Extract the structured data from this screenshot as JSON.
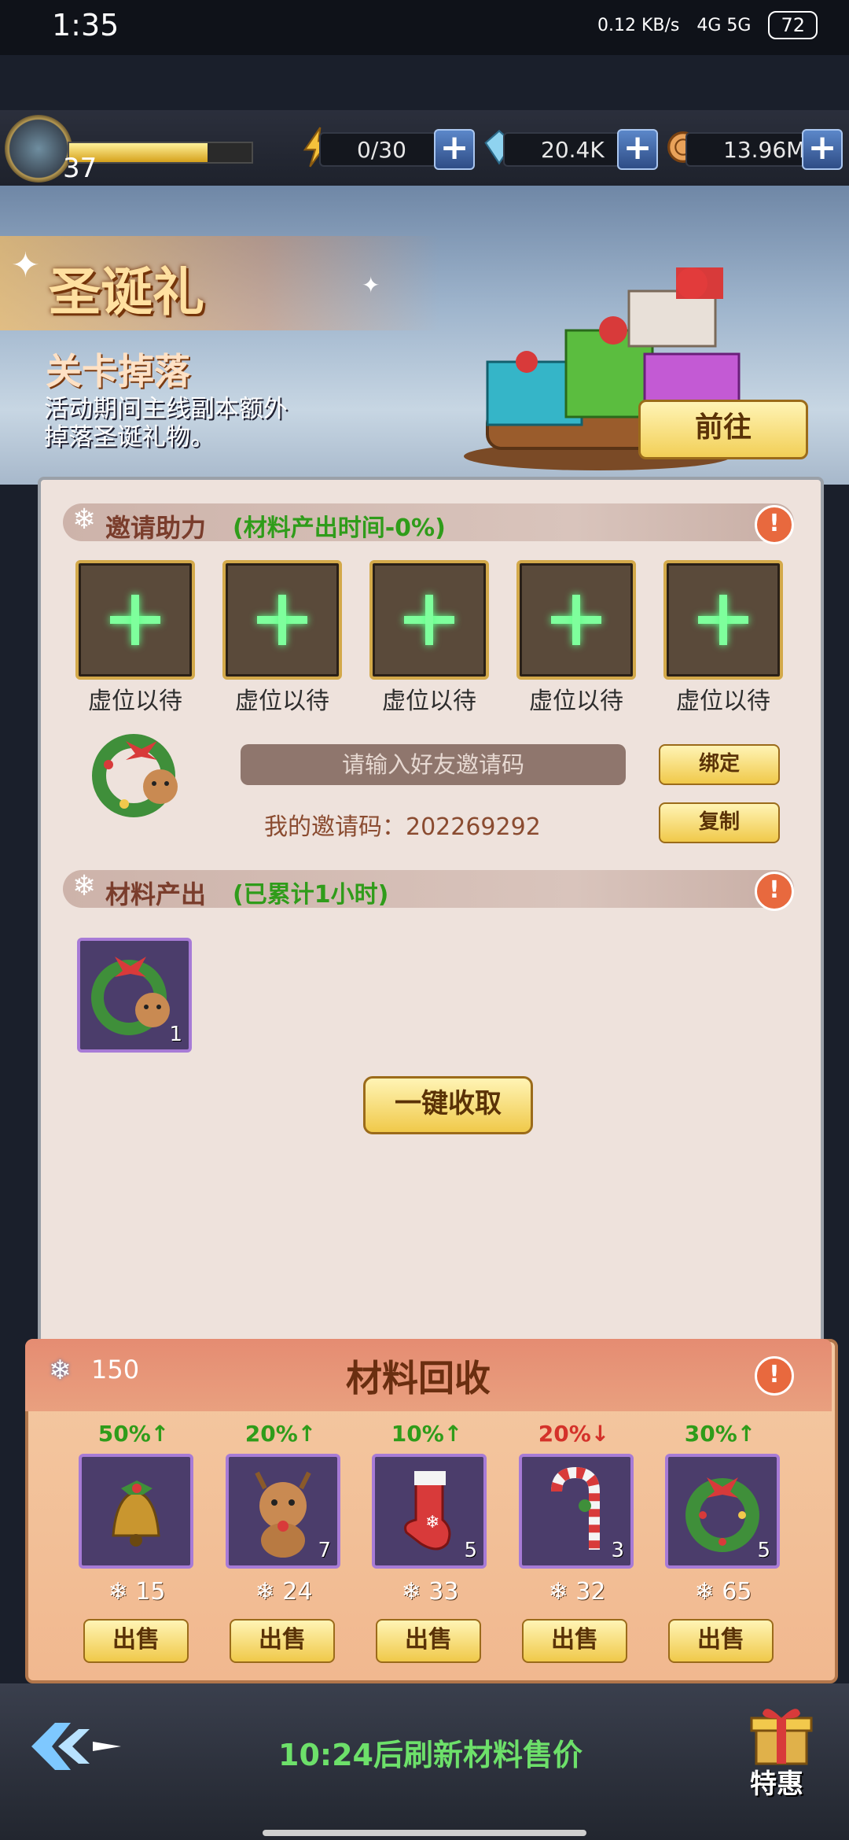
{
  "status": {
    "time": "1:35",
    "net_speed": "0.12 KB/s",
    "signal": "4G 5G",
    "battery": "72"
  },
  "player": {
    "level": "37",
    "xp_progress": 0.76
  },
  "resources": [
    {
      "icon": "energy-bolt-icon",
      "value": "0/30"
    },
    {
      "icon": "diamond-icon",
      "value": "20.4K"
    },
    {
      "icon": "coin-icon",
      "value": "13.96M"
    }
  ],
  "banner": {
    "title": "圣诞礼",
    "subtitle": "关卡掉落",
    "desc": "活动期间主线副本额外掉落圣诞礼物。",
    "goto_label": "前往"
  },
  "invite": {
    "header": "邀请助力",
    "header_note": "(材料产出时间-0%)",
    "slots": [
      "虚位以待",
      "虚位以待",
      "虚位以待",
      "虚位以待",
      "虚位以待"
    ],
    "input_placeholder": "请输入好友邀请码",
    "bind_label": "绑定",
    "copy_label": "复制",
    "my_code_label": "我的邀请码：202269292"
  },
  "output": {
    "header": "材料产出",
    "header_note": "(已累计1小时)",
    "items": [
      {
        "icon": "wreath-reindeer-icon",
        "count": "1"
      }
    ],
    "collect_label": "一键收取"
  },
  "recycle": {
    "snow_balance": "150",
    "title": "材料回收",
    "items": [
      {
        "icon": "bell-icon",
        "pct": "50%↑",
        "pct_color": "#2f9c1a",
        "count": "",
        "price": "15",
        "sell": "出售"
      },
      {
        "icon": "reindeer-icon",
        "pct": "20%↑",
        "pct_color": "#2f9c1a",
        "count": "7",
        "price": "24",
        "sell": "出售"
      },
      {
        "icon": "stocking-icon",
        "pct": "10%↑",
        "pct_color": "#2f9c1a",
        "count": "5",
        "price": "33",
        "sell": "出售"
      },
      {
        "icon": "candy-cane-icon",
        "pct": "20%↓",
        "pct_color": "#d4322a",
        "count": "3",
        "price": "32",
        "sell": "出售"
      },
      {
        "icon": "wreath-icon",
        "pct": "30%↑",
        "pct_color": "#2f9c1a",
        "count": "5",
        "price": "65",
        "sell": "出售"
      }
    ]
  },
  "footer": {
    "refresh_text": "10:24后刷新材料售价",
    "special_label": "特惠"
  }
}
